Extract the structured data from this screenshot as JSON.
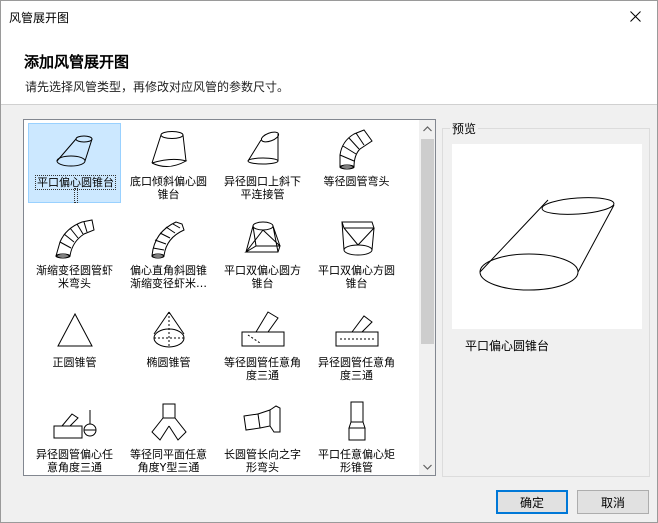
{
  "window": {
    "title": "风管展开图"
  },
  "header": {
    "title": "添加风管展开图",
    "subtitle": "请先选择风管类型，再修改对应风管的参数尺寸。"
  },
  "tiles": [
    {
      "line1": "平口偏心圆锥台",
      "line2": "",
      "selected": true,
      "icon": "offset-cone-frustum-icon"
    },
    {
      "line1": "底口倾斜偏心圆",
      "line2": "锥台",
      "icon": "sloped-offset-frustum-icon"
    },
    {
      "line1": "异径圆口上斜下",
      "line2": "平连接管",
      "icon": "reducer-slant-connector-icon"
    },
    {
      "line1": "等径圆管弯头",
      "line2": "",
      "icon": "segmented-elbow-icon"
    },
    {
      "line1": "渐缩变径圆管虾",
      "line2": "米弯头",
      "icon": "tapered-shrimp-elbow-icon"
    },
    {
      "line1": "偏心直角斜圆锥",
      "line2": "渐缩变径虾米…",
      "icon": "offset-oblique-cone-elbow-icon"
    },
    {
      "line1": "平口双偏心圆方",
      "line2": "锥台",
      "icon": "round-to-square-frustum-icon"
    },
    {
      "line1": "平口双偏心方圆",
      "line2": "锥台",
      "icon": "square-to-round-frustum-icon"
    },
    {
      "line1": "正圆锥管",
      "line2": "",
      "icon": "right-cone-icon"
    },
    {
      "line1": "椭圆锥管",
      "line2": "",
      "icon": "elliptic-cone-icon"
    },
    {
      "line1": "等径圆管任意角",
      "line2": "度三通",
      "icon": "equal-tee-angle-icon"
    },
    {
      "line1": "异径圆管任意角",
      "line2": "度三通",
      "icon": "reducing-tee-angle-icon"
    },
    {
      "line1": "异径圆管偏心任",
      "line2": "意角度三通",
      "icon": "eccentric-tee-icon"
    },
    {
      "line1": "等径同平面任意",
      "line2": "角度Y型三通",
      "icon": "y-branch-icon"
    },
    {
      "line1": "长圆管长向之字",
      "line2": "形弯头",
      "icon": "zigzag-elbow-icon"
    },
    {
      "line1": "平口任意偏心矩",
      "line2": "形锥管",
      "icon": "rectangular-offset-taper-icon"
    }
  ],
  "preview": {
    "label": "预览",
    "caption": "平口偏心圆锥台"
  },
  "buttons": {
    "ok": "确定",
    "cancel": "取消"
  }
}
